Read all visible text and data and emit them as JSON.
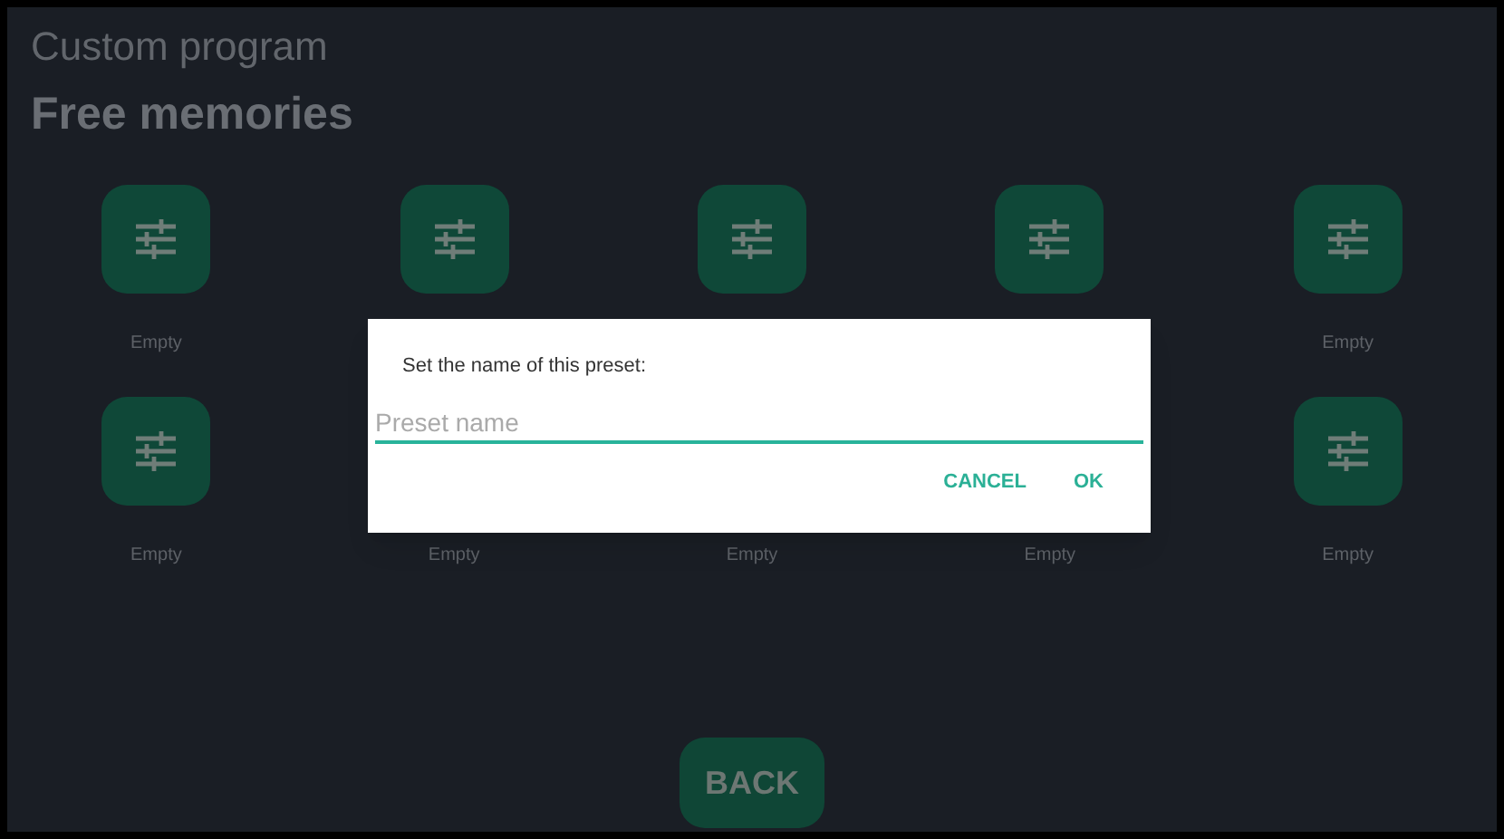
{
  "header": {
    "subtitle": "Custom program",
    "title": "Free memories"
  },
  "slots": [
    {
      "kind": "tile",
      "label": "Empty"
    },
    {
      "kind": "tile"
    },
    {
      "kind": "tile"
    },
    {
      "kind": "tile"
    },
    {
      "kind": "tile",
      "label": "Empty"
    },
    {
      "kind": "tile",
      "label": "Empty"
    },
    {
      "kind": "text",
      "label": "Empty"
    },
    {
      "kind": "text",
      "label": "Empty"
    },
    {
      "kind": "text",
      "label": "Empty"
    },
    {
      "kind": "tile",
      "label": "Empty"
    }
  ],
  "dialog": {
    "message": "Set the name of this preset:",
    "field": {
      "placeholder": "Preset name"
    },
    "buttons": [
      "CANCEL",
      "OK"
    ]
  },
  "back_button": "BACK"
}
